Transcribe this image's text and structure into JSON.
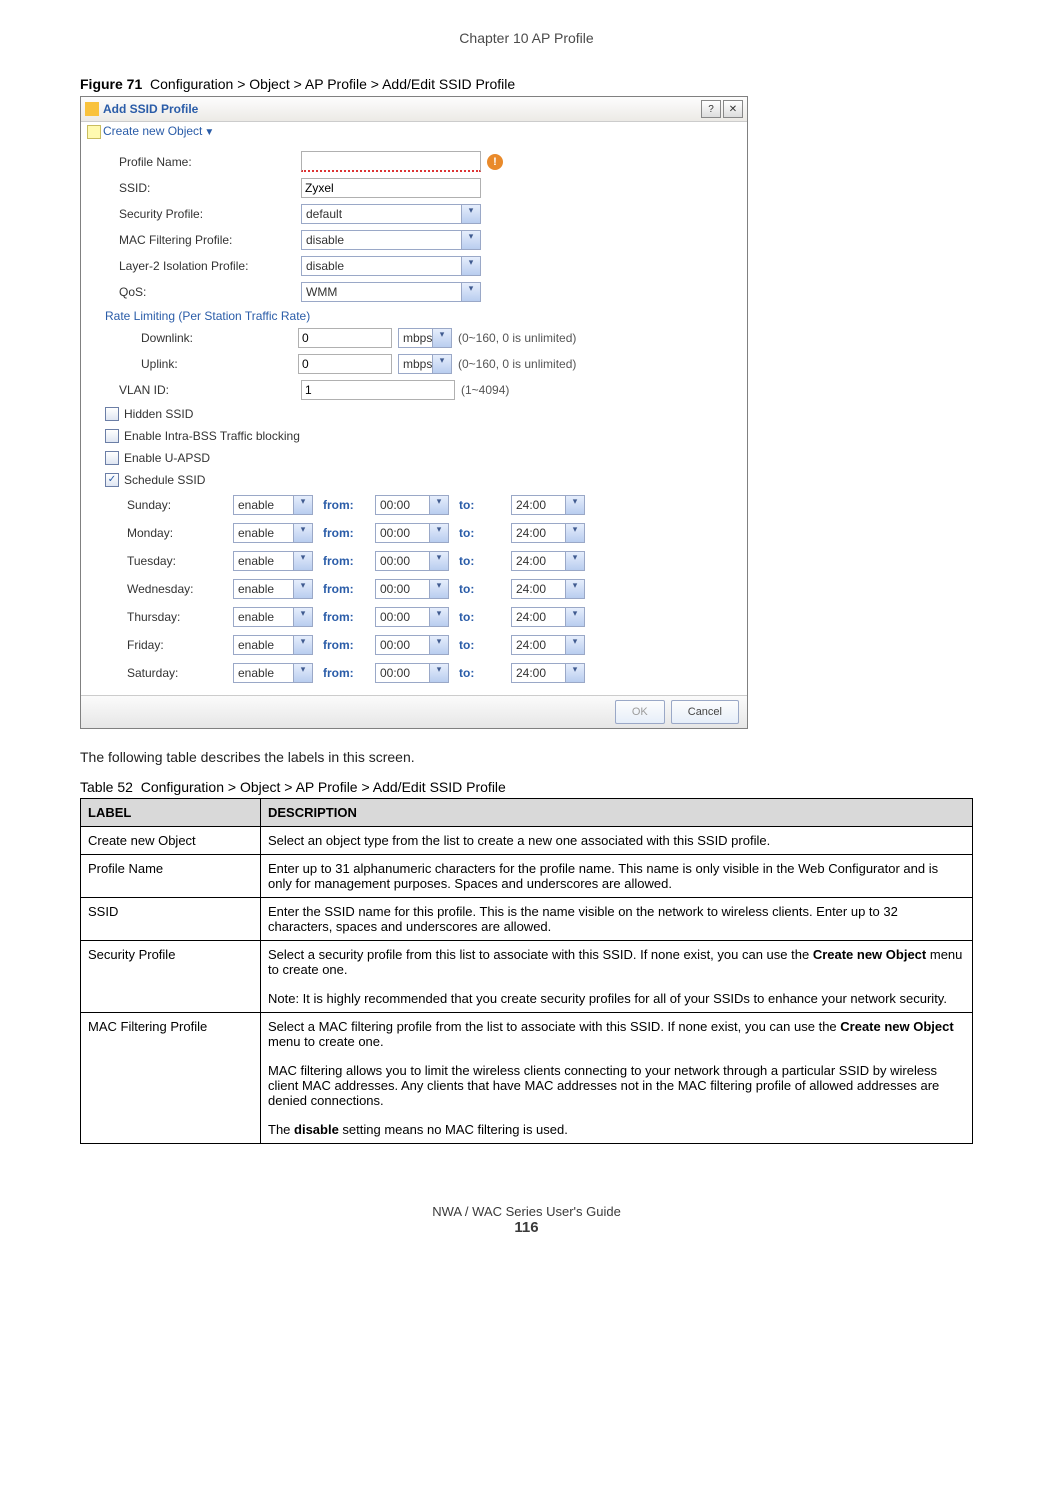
{
  "chapter": "Chapter 10 AP Profile",
  "figure": {
    "label": "Figure 71",
    "text": "Configuration > Object > AP Profile > Add/Edit SSID Profile"
  },
  "dialog": {
    "title": "Add SSID Profile",
    "create_new": "Create new Object",
    "fields": {
      "profile_name": {
        "lbl": "Profile Name:",
        "val": ""
      },
      "ssid": {
        "lbl": "SSID:",
        "val": "Zyxel"
      },
      "sec": {
        "lbl": "Security Profile:",
        "val": "default"
      },
      "mac": {
        "lbl": "MAC Filtering Profile:",
        "val": "disable"
      },
      "l2": {
        "lbl": "Layer-2 Isolation Profile:",
        "val": "disable"
      },
      "qos": {
        "lbl": "QoS:",
        "val": "WMM"
      },
      "rate_title": "Rate Limiting (Per Station Traffic Rate)",
      "down": {
        "lbl": "Downlink:",
        "val": "0",
        "unit": "mbps",
        "hint": "(0~160, 0 is unlimited)"
      },
      "up": {
        "lbl": "Uplink:",
        "val": "0",
        "unit": "mbps",
        "hint": "(0~160, 0 is unlimited)"
      },
      "vlan": {
        "lbl": "VLAN ID:",
        "val": "1",
        "hint": "(1~4094)"
      },
      "cb_hidden": "Hidden SSID",
      "cb_bss": "Enable Intra-BSS Traffic blocking",
      "cb_uapsd": "Enable U-APSD",
      "cb_sched": "Schedule SSID",
      "from": "from:",
      "to": "to:",
      "days": [
        {
          "day": "Sunday:",
          "en": "enable",
          "f": "00:00",
          "t": "24:00"
        },
        {
          "day": "Monday:",
          "en": "enable",
          "f": "00:00",
          "t": "24:00"
        },
        {
          "day": "Tuesday:",
          "en": "enable",
          "f": "00:00",
          "t": "24:00"
        },
        {
          "day": "Wednesday:",
          "en": "enable",
          "f": "00:00",
          "t": "24:00"
        },
        {
          "day": "Thursday:",
          "en": "enable",
          "f": "00:00",
          "t": "24:00"
        },
        {
          "day": "Friday:",
          "en": "enable",
          "f": "00:00",
          "t": "24:00"
        },
        {
          "day": "Saturday:",
          "en": "enable",
          "f": "00:00",
          "t": "24:00"
        }
      ]
    },
    "buttons": {
      "ok": "OK",
      "cancel": "Cancel"
    }
  },
  "intro": "The following table describes the labels in this screen.",
  "table_caption": {
    "label": "Table 52",
    "text": "Configuration > Object > AP Profile > Add/Edit SSID Profile"
  },
  "table": {
    "h1": "LABEL",
    "h2": "DESCRIPTION",
    "rows": [
      {
        "l": "Create new Object",
        "d": "Select an object type from the list to create a new one associated with this SSID profile."
      },
      {
        "l": "Profile Name",
        "d": "Enter up to 31 alphanumeric characters for the profile name. This name is only visible in the Web Configurator and is only for management purposes. Spaces and underscores are allowed."
      },
      {
        "l": "SSID",
        "d": "Enter the SSID name for this profile. This is the name visible on the network to wireless clients. Enter up to 32 characters, spaces and underscores are allowed."
      },
      {
        "l": "Security Profile",
        "d1": "Select a security profile from this list to associate with this SSID. If none exist, you can use the ",
        "bold1": "Create new Object",
        "d2": " menu to create one.",
        "note": "Note: It is highly recommended that you create security profiles for all of your SSIDs to enhance your network security."
      },
      {
        "l": "MAC Filtering Profile",
        "d1": "Select a MAC filtering profile from the list to associate with this SSID. If none exist, you can use the ",
        "bold1": "Create new Object",
        "d2": " menu to create one.",
        "p2": "MAC filtering allows you to limit the wireless clients connecting to your network through a particular SSID by wireless client MAC addresses. Any clients that have MAC addresses not in the MAC filtering profile of allowed addresses are denied connections.",
        "p3a": "The ",
        "p3b": "disable",
        "p3c": " setting means no MAC filtering is used."
      }
    ]
  },
  "footer": {
    "guide": "NWA / WAC Series User's Guide",
    "page": "116"
  }
}
